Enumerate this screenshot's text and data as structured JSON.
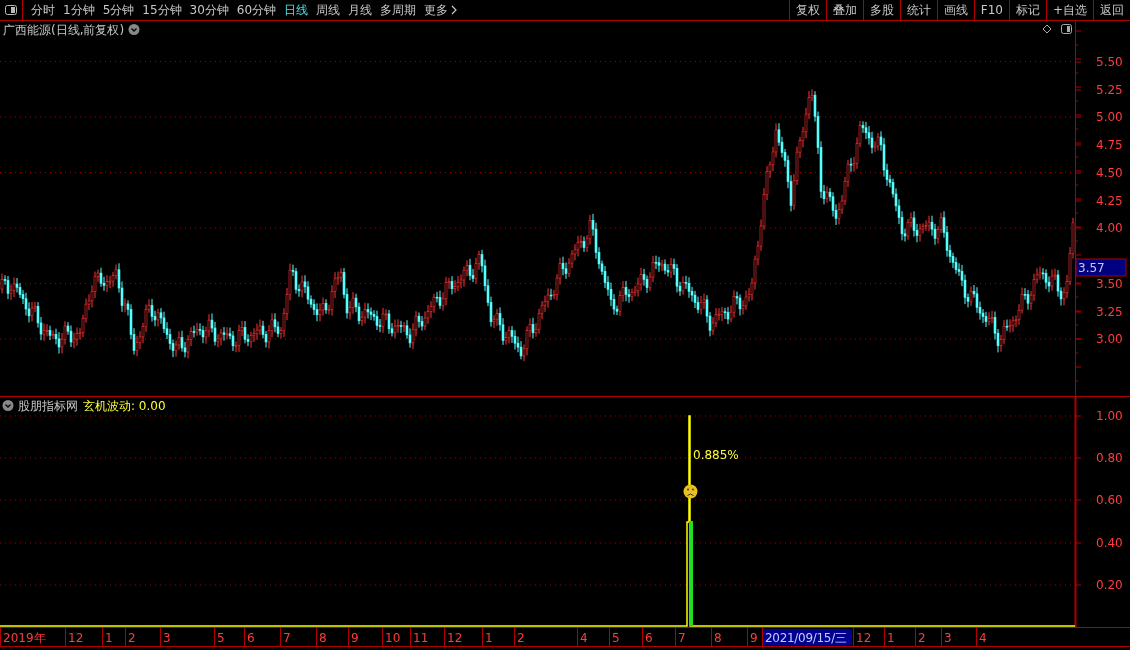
{
  "toolbar": {
    "periods": [
      {
        "label": "分时",
        "selected": false
      },
      {
        "label": "1分钟",
        "selected": false
      },
      {
        "label": "5分钟",
        "selected": false
      },
      {
        "label": "15分钟",
        "selected": false
      },
      {
        "label": "30分钟",
        "selected": false
      },
      {
        "label": "60分钟",
        "selected": false
      },
      {
        "label": "日线",
        "selected": true
      },
      {
        "label": "周线",
        "selected": false
      },
      {
        "label": "月线",
        "selected": false
      },
      {
        "label": "多周期",
        "selected": false
      },
      {
        "label": "更多",
        "selected": false
      }
    ],
    "buttons": [
      "复权",
      "叠加",
      "多股",
      "统计",
      "画线",
      "F10",
      "标记",
      "+自选",
      "返回"
    ]
  },
  "price_pane": {
    "title": "广西能源(日线,前复权)",
    "axis_labels": [
      "5.50",
      "5.25",
      "5.00",
      "4.75",
      "4.50",
      "4.25",
      "4.00",
      "3.50",
      "3.25",
      "3.00"
    ],
    "price_tag": "3.57"
  },
  "indicator_pane": {
    "source": "股朋指标网",
    "indicator": "玄机波动: 0.00",
    "annotation": "0.885%",
    "axis_labels": [
      "1.00",
      "0.80",
      "0.60",
      "0.40",
      "0.20"
    ]
  },
  "date_axis": [
    {
      "label": "2019年",
      "selected": false
    },
    {
      "label": "12",
      "selected": false
    },
    {
      "label": "1",
      "selected": false
    },
    {
      "label": "2",
      "selected": false
    },
    {
      "label": "3",
      "selected": false
    },
    {
      "label": "5",
      "selected": false
    },
    {
      "label": "6",
      "selected": false
    },
    {
      "label": "7",
      "selected": false
    },
    {
      "label": "8",
      "selected": false
    },
    {
      "label": "9",
      "selected": false
    },
    {
      "label": "10",
      "selected": false
    },
    {
      "label": "11",
      "selected": false
    },
    {
      "label": "12",
      "selected": false
    },
    {
      "label": "1",
      "selected": false
    },
    {
      "label": "2",
      "selected": false
    },
    {
      "label": "4",
      "selected": false
    },
    {
      "label": "5",
      "selected": false
    },
    {
      "label": "6",
      "selected": false
    },
    {
      "label": "7",
      "selected": false
    },
    {
      "label": "8",
      "selected": false
    },
    {
      "label": "9",
      "selected": false
    },
    {
      "label": "2021/09/15/三",
      "selected": true
    },
    {
      "label": "12",
      "selected": false
    },
    {
      "label": "1",
      "selected": false
    },
    {
      "label": "2",
      "selected": false
    },
    {
      "label": "3",
      "selected": false
    },
    {
      "label": "4",
      "selected": false
    }
  ]
}
